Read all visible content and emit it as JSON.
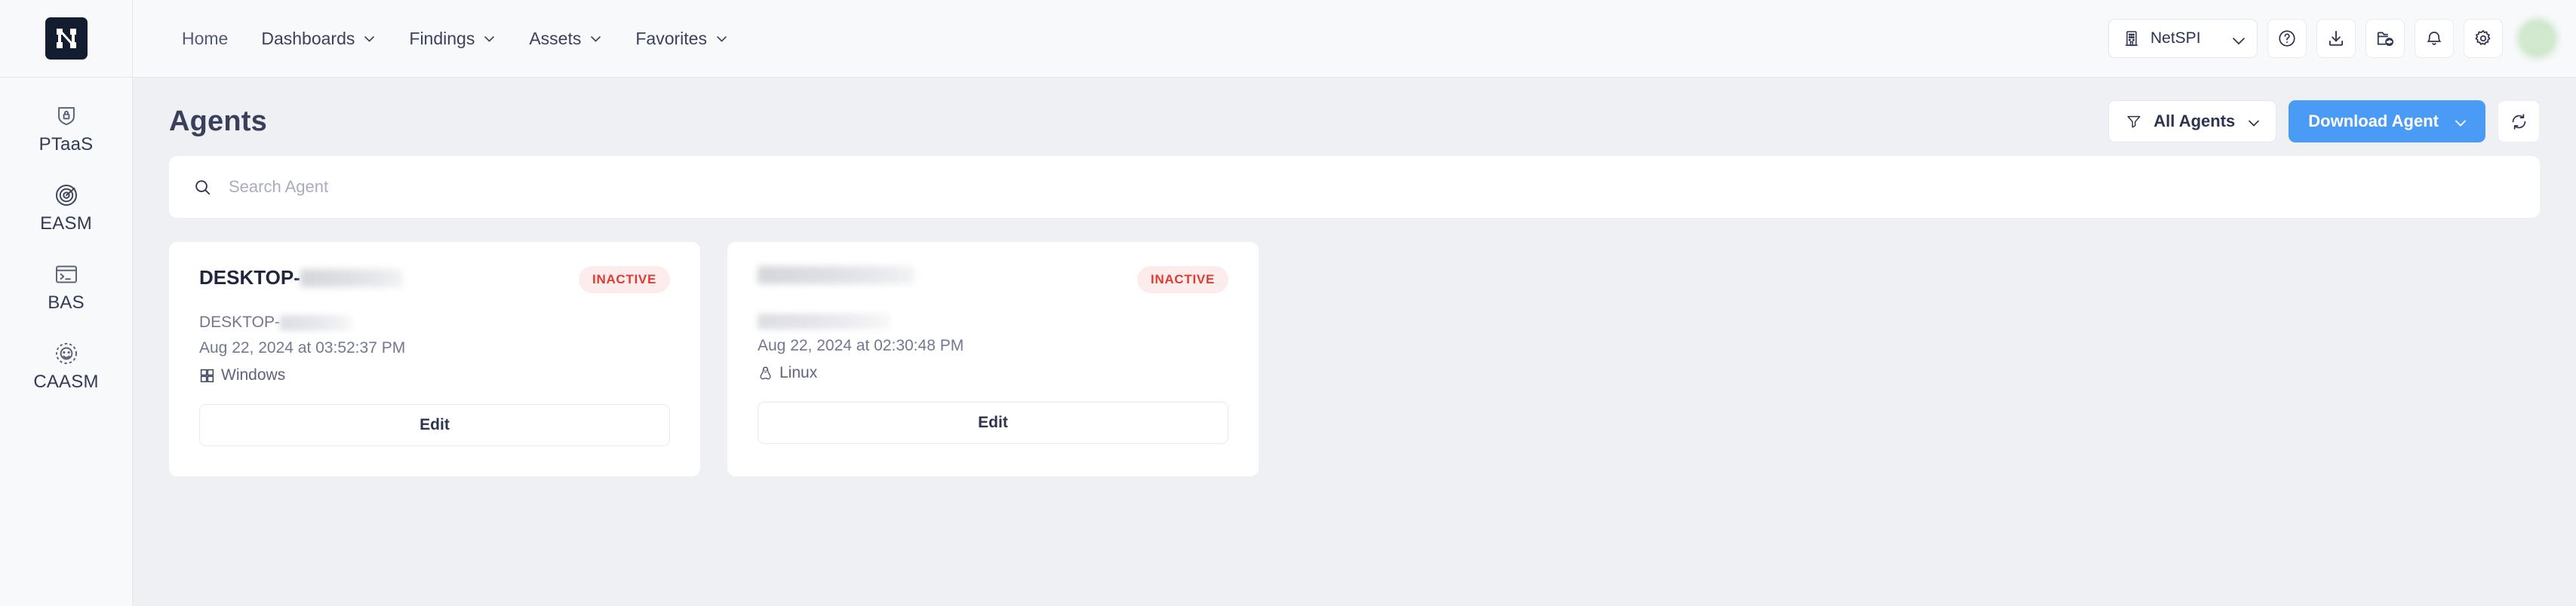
{
  "brand": {
    "logo_letter": "N",
    "logo_bg": "#141d30"
  },
  "topnav": {
    "items": [
      {
        "label": "Home",
        "has_caret": false
      },
      {
        "label": "Dashboards",
        "has_caret": true
      },
      {
        "label": "Findings",
        "has_caret": true
      },
      {
        "label": "Assets",
        "has_caret": true
      },
      {
        "label": "Favorites",
        "has_caret": true
      }
    ],
    "org": {
      "name": "NetSPI",
      "icon": "building-icon",
      "caret": "chevron-down-icon"
    },
    "icon_buttons": [
      {
        "name": "help-icon"
      },
      {
        "name": "download-icon"
      },
      {
        "name": "folder-sync-icon"
      },
      {
        "name": "notification-bell-icon"
      },
      {
        "name": "settings-gear-icon"
      }
    ],
    "avatar": {
      "name": "user-avatar",
      "color": "#d3ead0"
    }
  },
  "sidebar": {
    "items": [
      {
        "label": "PTaaS",
        "icon": "shield-lock-icon"
      },
      {
        "label": "EASM",
        "icon": "target-radar-icon"
      },
      {
        "label": "BAS",
        "icon": "terminal-icon"
      },
      {
        "label": "CAASM",
        "icon": "network-node-icon"
      }
    ]
  },
  "page": {
    "title": "Agents",
    "filter_label": "All Agents",
    "filter_icon": "filter-funnel-icon",
    "download_label": "Download Agent",
    "refresh_icon": "refresh-icon",
    "accent_color": "#4a9bf5"
  },
  "search": {
    "placeholder": "Search Agent",
    "value": "",
    "icon": "search-icon"
  },
  "agents": [
    {
      "title_prefix": "DESKTOP-",
      "title_redacted": true,
      "title_redact_width": 68,
      "status": "INACTIVE",
      "status_color": "#e03b33",
      "subtitle_prefix": "DESKTOP-",
      "subtitle_redacted": true,
      "subtitle_redact_width": 48,
      "date": "Aug 22, 2024 at 03:52:37 PM",
      "os": "Windows",
      "os_icon": "windows-icon",
      "edit_label": "Edit"
    },
    {
      "title_prefix": "",
      "title_redacted": true,
      "title_redact_width": 104,
      "status": "INACTIVE",
      "status_color": "#e03b33",
      "subtitle_prefix": "",
      "subtitle_redacted": true,
      "subtitle_redact_width": 88,
      "date": "Aug 22, 2024 at 02:30:48 PM",
      "os": "Linux",
      "os_icon": "linux-penguin-icon",
      "edit_label": "Edit"
    }
  ]
}
